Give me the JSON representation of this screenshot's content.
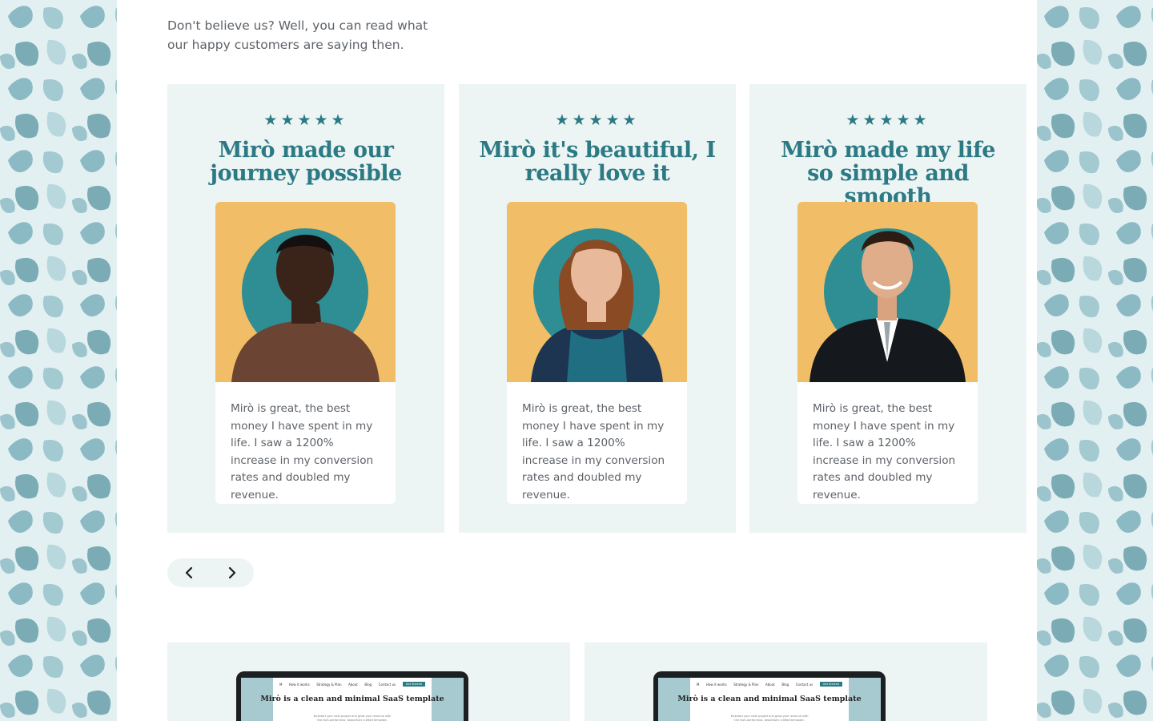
{
  "intro": {
    "text": "Don't believe us? Well, you can read what our happy customers are saying then."
  },
  "testimonials": [
    {
      "rating": 5,
      "stars": "★★★★★",
      "headline": "Mirò made our journey possible",
      "quote": "Mirò is great, the best money I have spent in my life. I saw a 1200% increase in my conversion rates and doubled my revenue."
    },
    {
      "rating": 5,
      "stars": "★★★★★",
      "headline": "Mirò it's beautiful, I really love it",
      "quote": "Mirò is great, the best money I have spent in my life. I saw a 1200% increase in my conversion rates and doubled my revenue."
    },
    {
      "rating": 5,
      "stars": "★★★★★",
      "headline": "Mirò made my life so simple and smooth",
      "quote": "Mirò is great, the best money I have spent in my life. I saw a 1200% increase in my conversion rates and doubled my revenue."
    }
  ],
  "slider": {
    "prev_icon": "chevron-left-icon",
    "next_icon": "chevron-right-icon"
  },
  "previews": [
    {
      "logo": "M",
      "nav": [
        "How it works",
        "Strategy & Plan",
        "About",
        "Blog",
        "Contact us"
      ],
      "cta": "Get Started",
      "title": "Mirò is a clean and minimal SaaS template",
      "subtitle": "Kickstart your next project and grow your revenue with the high-performing, beautifully crafted template."
    },
    {
      "logo": "M",
      "nav": [
        "How it works",
        "Strategy & Plan",
        "About",
        "Blog",
        "Contact us"
      ],
      "cta": "Get Started",
      "title": "Mirò is a clean and minimal SaaS template",
      "subtitle": "Kickstart your next project and grow your revenue with the high-performing, beautifully crafted template."
    }
  ],
  "colors": {
    "accent": "#2b7a84",
    "card_bg": "#edf4f4",
    "photo_bg": "#f1bd66",
    "body_text": "#5d6268"
  }
}
